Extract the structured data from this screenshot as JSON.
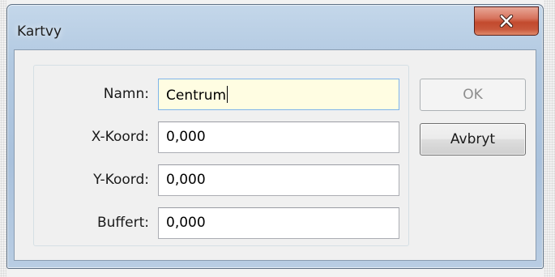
{
  "window": {
    "title": "Kartvy"
  },
  "icons": {
    "close": "close-x-icon"
  },
  "colors": {
    "close_button": "#c24a2e",
    "active_field_bg": "#fffde2",
    "title_bar": "#b2c9e1"
  },
  "form": {
    "fields": [
      {
        "label": "Namn:",
        "value": "Centrum"
      },
      {
        "label": "X-Koord:",
        "value": "0,000"
      },
      {
        "label": "Y-Koord:",
        "value": "0,000"
      },
      {
        "label": "Buffert:",
        "value": "0,000"
      }
    ]
  },
  "buttons": {
    "ok_label": "OK",
    "cancel_label": "Avbryt"
  }
}
